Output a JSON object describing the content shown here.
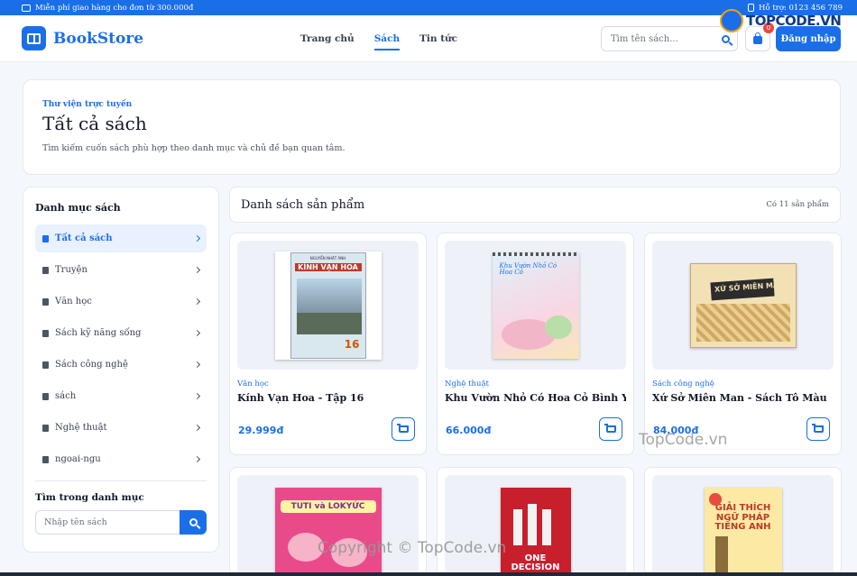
{
  "topbar": {
    "shipping_text": "Miễn phí giao hàng cho đơn từ 300.000đ",
    "support_text": "Hỗ trợ: 0123 456 789"
  },
  "header": {
    "brand": "BookStore",
    "nav": [
      "Trang chủ",
      "Sách",
      "Tin tức"
    ],
    "active_nav": "Sách",
    "search_placeholder": "Tìm tên sách...",
    "cart_count": "0",
    "login_label": "Đăng nhập"
  },
  "hero": {
    "eyebrow": "Thư viện trực tuyến",
    "title": "Tất cả sách",
    "subtitle": "Tìm kiếm cuốn sách phù hợp theo danh mục và chủ đề bạn quan tâm."
  },
  "sidebar": {
    "title": "Danh mục sách",
    "items": [
      {
        "label": "Tất cả sách",
        "active": true
      },
      {
        "label": "Truyện"
      },
      {
        "label": "Văn học"
      },
      {
        "label": "Sách kỹ năng sống"
      },
      {
        "label": "Sách công nghệ"
      },
      {
        "label": "sách"
      },
      {
        "label": "Nghệ thuật"
      },
      {
        "label": "ngoai-ngu"
      }
    ],
    "search_title": "Tìm trong danh mục",
    "search_placeholder": "Nhập tên sách"
  },
  "products": {
    "heading": "Danh sách sản phẩm",
    "count_text": "Có 11 sản phẩm",
    "items": [
      {
        "category": "Văn học",
        "title": "Kính Vạn Hoa - Tập 16",
        "price": "29.999đ",
        "cover_title": "KÍNH VẠN HOA",
        "cover_author": "NGUYỄN NHẬT ÁNH",
        "cover_number": "16"
      },
      {
        "category": "Nghệ thuật",
        "title": "Khu Vườn Nhỏ Có Hoa Cỏ Bình Yên",
        "price": "66.000đ",
        "cover_title": "Khu Vườn Nhỏ Có Hoa Cỏ"
      },
      {
        "category": "Sách công nghệ",
        "title": "Xứ Sở Miên Man - Sách Tô Màu",
        "price": "84.000đ",
        "cover_title": "XỨ SỞ MIÊN MAN"
      },
      {
        "cover_title": "TUTI và LOKYỨC"
      },
      {
        "cover_title": "ONE DECISION"
      },
      {
        "cover_title": "GIẢI THÍCH NGỮ PHÁP TIẾNG ANH"
      }
    ]
  },
  "watermarks": {
    "logo": "TOPCODE.VN",
    "middle": "TopCode.vn",
    "bottom": "Copyright © TopCode.vn"
  },
  "colors": {
    "primary": "#1a6fe8",
    "background": "#f4f7fb"
  },
  "icons": [
    "truck-icon",
    "phone-icon",
    "book-logo-icon",
    "search-icon",
    "shopping-bag-icon",
    "book-icon",
    "chevron-right-icon",
    "cart-icon"
  ]
}
